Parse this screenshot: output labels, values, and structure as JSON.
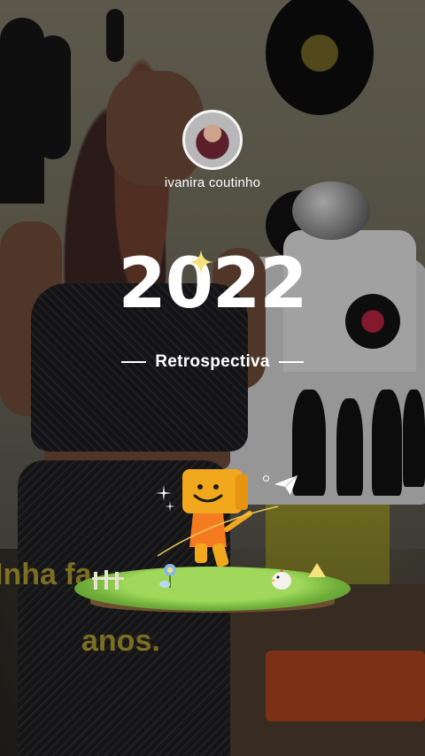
{
  "story": {
    "username": "ivanira coutinho",
    "year": "2022",
    "subtitle": "Retrospectiva",
    "caption_line1": "Inha fa",
    "caption_line2": "anos."
  },
  "colors": {
    "title_text": "#ffffff",
    "caption_text": "#cdb428",
    "mascot_body": "#f2a81d",
    "mascot_legs": "#e8702a",
    "grass": "#8cc84b"
  },
  "icons": [
    "sparkle-icon",
    "paper-plane-icon",
    "star-icon",
    "chicken-icon",
    "flower-icon"
  ]
}
